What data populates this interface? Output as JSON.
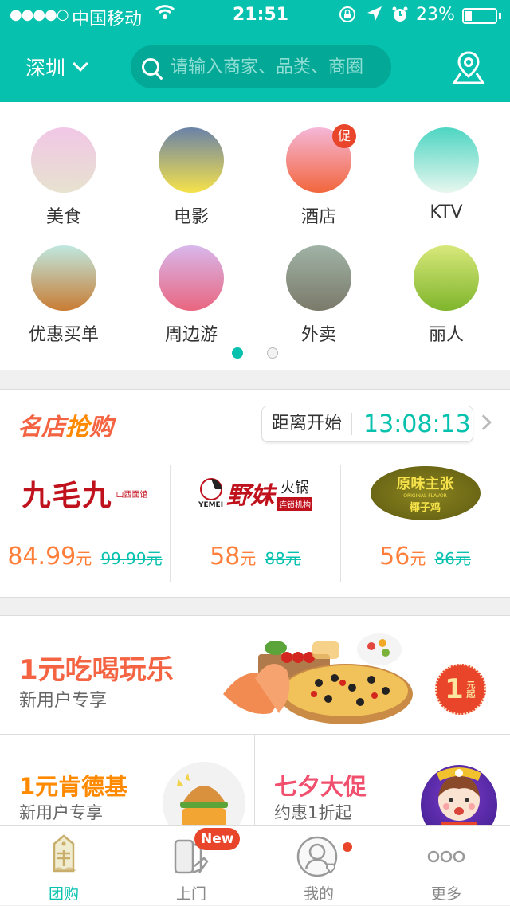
{
  "status_bar": {
    "signal": "●●●●○",
    "carrier": "中国移动",
    "time": "21:51",
    "battery_percent": "23%",
    "battery_level": 0.23
  },
  "header": {
    "city": "深圳",
    "search_placeholder": "请输入商家、品类、商圈"
  },
  "categories": [
    {
      "label": "美食",
      "icon": "magpie-icon",
      "colors": [
        "#f1c7e6",
        "#e7e2cf"
      ]
    },
    {
      "label": "电影",
      "icon": "moon-bridge-icon",
      "colors": [
        "#6a82a8",
        "#f6e24a"
      ]
    },
    {
      "label": "酒店",
      "icon": "hearts-icon",
      "colors": [
        "#f5b7d8",
        "#f2663c"
      ],
      "badge": "促"
    },
    {
      "label": "KTV",
      "icon": "cloud-icon",
      "colors": [
        "#4dd5c2",
        "#e8f7ef"
      ]
    },
    {
      "label": "优惠买单",
      "icon": "ox-icon",
      "colors": [
        "#bfe8e0",
        "#c87c33"
      ]
    },
    {
      "label": "周边游",
      "icon": "flower-icon",
      "colors": [
        "#d8b8ec",
        "#e9667f"
      ]
    },
    {
      "label": "外卖",
      "icon": "hand-icon",
      "colors": [
        "#9fb3a6",
        "#7b7a6a"
      ]
    },
    {
      "label": "丽人",
      "icon": "bamboo-icon",
      "colors": [
        "#d8e87a",
        "#7fb52c"
      ]
    }
  ],
  "pager": {
    "pages": 2,
    "active": 0
  },
  "flash_sale": {
    "title_part1": "名店",
    "title_part2": "抢",
    "title_part3": "购",
    "countdown_label": "距离开始",
    "countdown": "13:08:13",
    "deals": [
      {
        "brand": "九毛九",
        "brand_sub": "山西面馆",
        "price": "84.99",
        "unit": "元",
        "original": "99.99元"
      },
      {
        "brand": "野妹",
        "brand_sub": "火锅",
        "brand_tag": "连锁机构",
        "brand_en": "YEMEI",
        "price": "58",
        "unit": "元",
        "original": "88元"
      },
      {
        "brand": "原味主张",
        "brand_sub": "椰子鸡",
        "brand_en": "ORIGINAL FLAVOR",
        "price": "56",
        "unit": "元",
        "original": "86元"
      }
    ]
  },
  "promo_banner": {
    "title": "1元吃喝玩乐",
    "subtitle": "新用户专享",
    "badge_line1": "1",
    "badge_line2": "元起"
  },
  "promo_halves": [
    {
      "title": "1元肯德基",
      "subtitle": "新用户专享",
      "color": "#ff8a00"
    },
    {
      "title": "七夕大促",
      "subtitle": "约惠1折起",
      "color": "#f0506e"
    }
  ],
  "tabbar": [
    {
      "label": "团购",
      "active": true
    },
    {
      "label": "上门",
      "badge": "New"
    },
    {
      "label": "我的",
      "dot": true
    },
    {
      "label": "更多",
      "glyph": "ooo"
    }
  ]
}
